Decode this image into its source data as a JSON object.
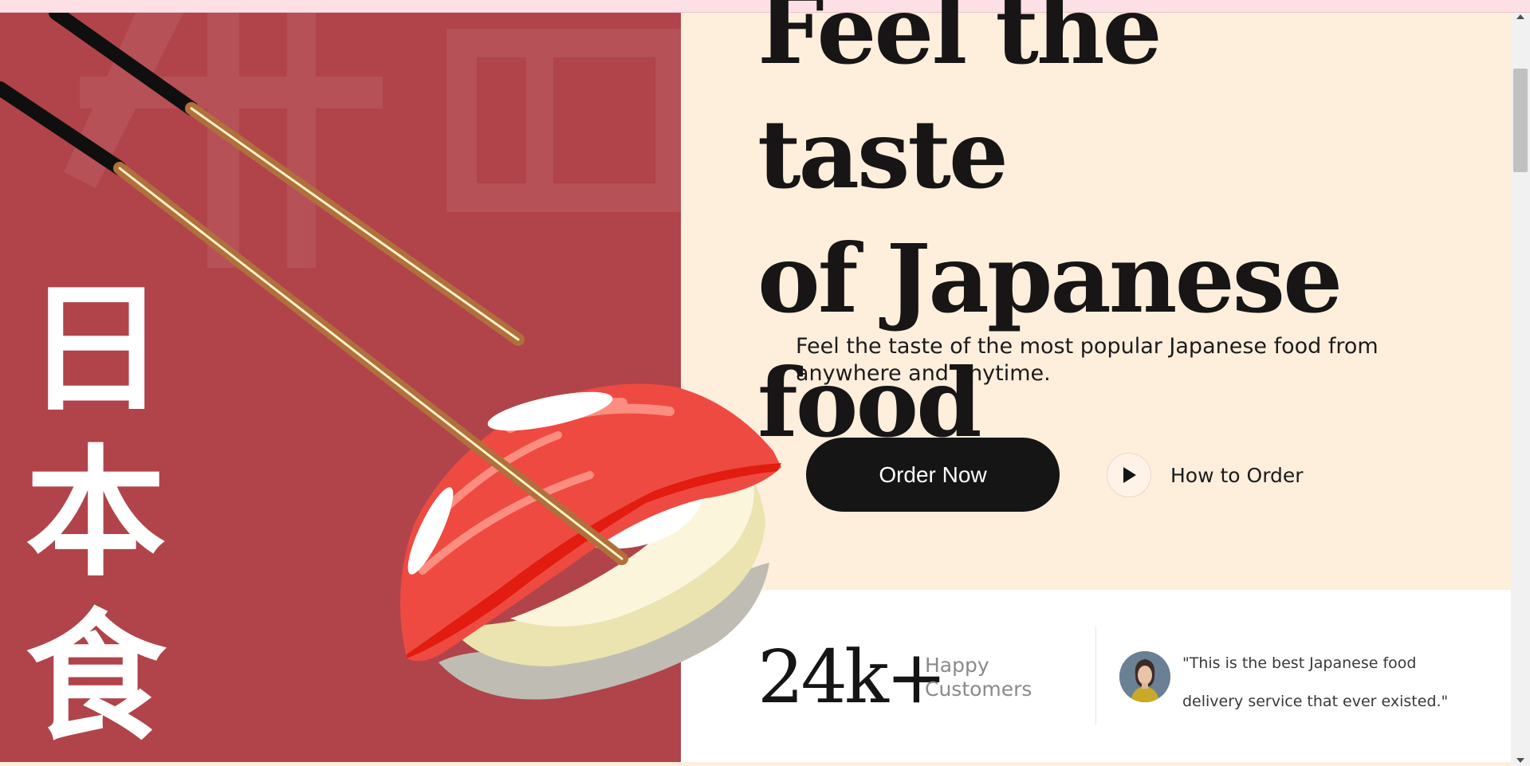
{
  "hero": {
    "headline_lines": [
      "Feel the taste",
      "of Japanese",
      "food"
    ],
    "subtitle": "Feel the taste of the most popular Japanese food from anywhere and anytime.",
    "order_button_label": "Order Now",
    "how_to_order_label": "How to Order",
    "vertical_text": [
      "日",
      "本",
      "食"
    ],
    "background_kanji": "料理"
  },
  "stats": {
    "customers_number": "24k+",
    "customers_label": "Happy Customers",
    "testimonial": "\"This is the best Japanese food delivery service that ever existed.\""
  },
  "colors": {
    "left_panel": "#b0444a",
    "right_panel": "#feefdd",
    "button": "#151515",
    "text": "#171515"
  },
  "icons": {
    "play": "play-icon",
    "avatar": "customer-avatar"
  }
}
